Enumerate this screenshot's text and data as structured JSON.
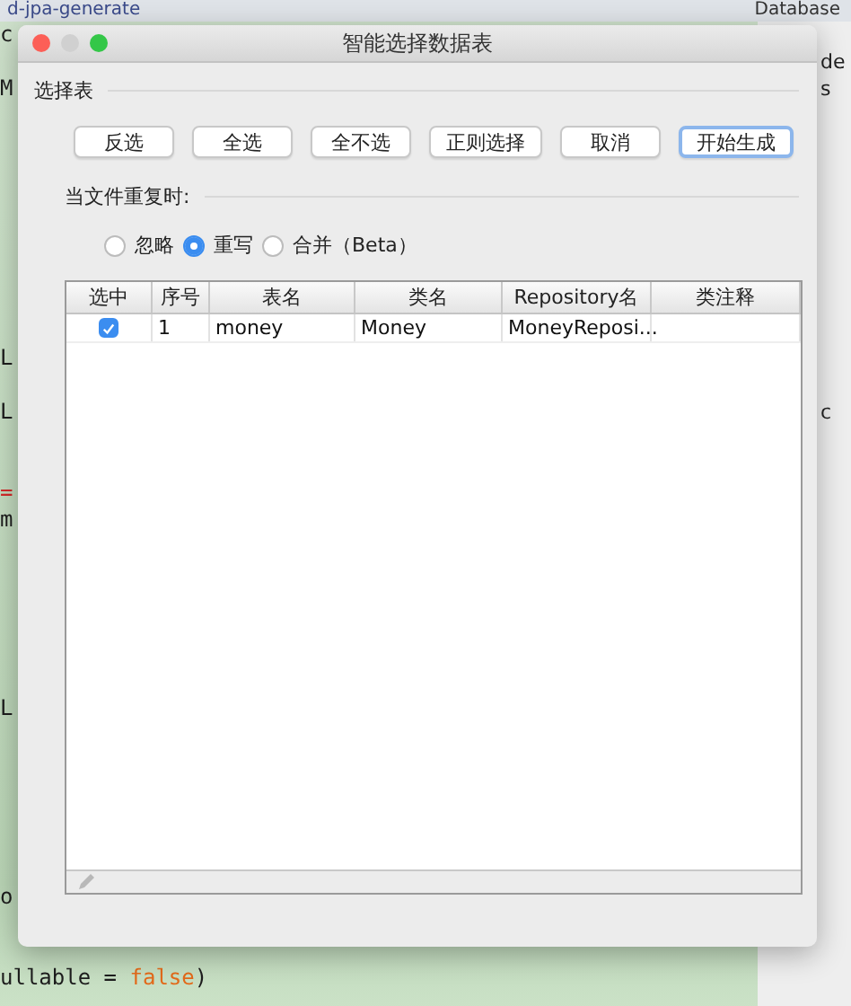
{
  "ide": {
    "editor_tab": "d-jpa-generate",
    "code_lines": [
      {
        "parts": [
          {
            "text": "c",
            "kind": "plain"
          }
        ]
      },
      {
        "parts": [
          {
            "text": "M",
            "kind": "plain"
          }
        ]
      },
      {
        "parts": [
          {
            "text": "L",
            "kind": "plain"
          }
        ]
      },
      {
        "parts": [
          {
            "text": "L",
            "kind": "plain"
          }
        ]
      },
      {
        "parts": [
          {
            "text": "=",
            "kind": "operator"
          }
        ]
      },
      {
        "parts": [
          {
            "text": "m",
            "kind": "plain"
          }
        ]
      },
      {
        "parts": [
          {
            "text": "L",
            "kind": "plain"
          }
        ]
      },
      {
        "parts": [
          {
            "text": "o",
            "kind": "plain"
          }
        ]
      },
      {
        "parts": [
          {
            "text": "ullable = ",
            "kind": "plain"
          },
          {
            "text": "false",
            "kind": "keyword"
          },
          {
            "text": ")",
            "kind": "plain"
          }
        ]
      }
    ],
    "side_panel": {
      "title": "Database",
      "items": [
        {
          "text": "de"
        },
        {
          "text": "s"
        },
        {
          "text": "c"
        }
      ]
    }
  },
  "dialog": {
    "title": "智能选择数据表",
    "table_section": "选择表",
    "buttons": [
      {
        "label": "反选",
        "default": false
      },
      {
        "label": "全选",
        "default": false
      },
      {
        "label": "全不选",
        "default": false
      },
      {
        "label": "正则选择",
        "default": false
      },
      {
        "label": "取消",
        "default": false
      },
      {
        "label": "开始生成",
        "default": true
      }
    ],
    "duplicate_label": "当文件重复时:",
    "options": [
      {
        "label": "忽略",
        "selected": false
      },
      {
        "label": "重写",
        "selected": true
      },
      {
        "label": "合并（Beta）",
        "selected": false
      }
    ],
    "table": {
      "columns": [
        "选中",
        "序号",
        "表名",
        "类名",
        "Repository名",
        "类注释"
      ],
      "rows": [
        {
          "checked": true,
          "cells": [
            "",
            "1",
            "money",
            "Money",
            "MoneyReposi...",
            ""
          ]
        }
      ]
    }
  }
}
